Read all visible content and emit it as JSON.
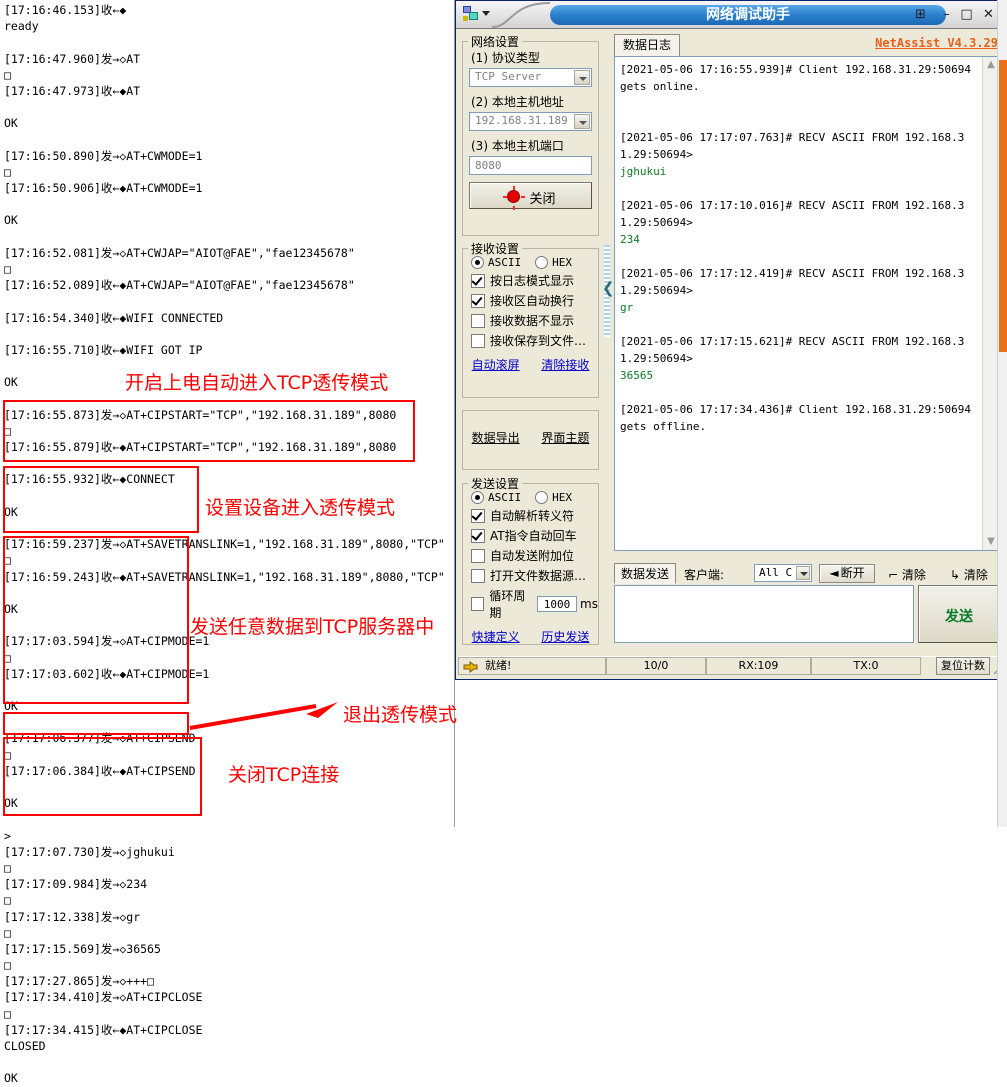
{
  "serial_log": {
    "lines": [
      "[17:16:46.153]收←◆",
      "ready",
      "",
      "[17:16:47.960]发→◇AT",
      "□",
      "[17:16:47.973]收←◆AT",
      "",
      "OK",
      "",
      "[17:16:50.890]发→◇AT+CWMODE=1",
      "□",
      "[17:16:50.906]收←◆AT+CWMODE=1",
      "",
      "OK",
      "",
      "[17:16:52.081]发→◇AT+CWJAP=\"AIOT@FAE\",\"fae12345678\"",
      "□",
      "[17:16:52.089]收←◆AT+CWJAP=\"AIOT@FAE\",\"fae12345678\"",
      "",
      "[17:16:54.340]收←◆WIFI CONNECTED",
      "",
      "[17:16:55.710]收←◆WIFI GOT IP",
      "",
      "OK",
      "",
      "[17:16:55.873]发→◇AT+CIPSTART=\"TCP\",\"192.168.31.189\",8080",
      "□",
      "[17:16:55.879]收←◆AT+CIPSTART=\"TCP\",\"192.168.31.189\",8080",
      "",
      "[17:16:55.932]收←◆CONNECT",
      "",
      "OK",
      "",
      "[17:16:59.237]发→◇AT+SAVETRANSLINK=1,\"192.168.31.189\",8080,\"TCP\"",
      "□",
      "[17:16:59.243]收←◆AT+SAVETRANSLINK=1,\"192.168.31.189\",8080,\"TCP\"",
      "",
      "OK",
      "",
      "[17:17:03.594]发→◇AT+CIPMODE=1",
      "□",
      "[17:17:03.602]收←◆AT+CIPMODE=1",
      "",
      "OK",
      "",
      "[17:17:06.377]发→◇AT+CIPSEND",
      "□",
      "[17:17:06.384]收←◆AT+CIPSEND",
      "",
      "OK",
      "",
      ">",
      "[17:17:07.730]发→◇jghukui",
      "□",
      "[17:17:09.984]发→◇234",
      "□",
      "[17:17:12.338]发→◇gr",
      "□",
      "[17:17:15.569]发→◇36565",
      "□",
      "[17:17:27.865]发→◇+++□",
      "[17:17:34.410]发→◇AT+CIPCLOSE",
      "□",
      "[17:17:34.415]收←◆AT+CIPCLOSE",
      "CLOSED",
      "",
      "OK"
    ]
  },
  "annotations": [
    {
      "id": "ann-tcp-auto",
      "text": "开启上电自动进入TCP透传模式"
    },
    {
      "id": "ann-transmit",
      "text": "设置设备进入透传模式"
    },
    {
      "id": "ann-senddata",
      "text": "发送任意数据到TCP服务器中"
    },
    {
      "id": "ann-exitmode",
      "text": "退出透传模式"
    },
    {
      "id": "ann-closetcp",
      "text": "关闭TCP连接"
    }
  ],
  "netassist": {
    "title": "网络调试助手",
    "brand_version": "NetAssist V4.3.29",
    "titlebar": {
      "pin": "⊞",
      "minimize": "–",
      "maximize": "□",
      "close": "✕"
    },
    "network_settings": {
      "legend": "网络设置",
      "protocol_label": "(1) 协议类型",
      "protocol_value": "TCP Server",
      "host_label": "(2) 本地主机地址",
      "host_value": "192.168.31.189",
      "port_label": "(3) 本地主机端口",
      "port_value": "8080",
      "action_button": "关闭"
    },
    "receive_settings": {
      "legend": "接收设置",
      "ascii": "ASCII",
      "hex": "HEX",
      "ascii_selected": true,
      "options": [
        {
          "label": "按日志模式显示",
          "checked": true
        },
        {
          "label": "接收区自动换行",
          "checked": true
        },
        {
          "label": "接收数据不显示",
          "checked": false
        },
        {
          "label": "接收保存到文件…",
          "checked": false
        }
      ],
      "links": [
        "自动滚屏",
        "清除接收"
      ]
    },
    "tools": {
      "links": [
        "数据导出",
        "界面主题"
      ]
    },
    "send_settings": {
      "legend": "发送设置",
      "ascii": "ASCII",
      "hex": "HEX",
      "ascii_selected": true,
      "options": [
        {
          "label": "自动解析转义符",
          "checked": true
        },
        {
          "label": "AT指令自动回车",
          "checked": true
        },
        {
          "label": "自动发送附加位",
          "checked": false
        },
        {
          "label": "打开文件数据源…",
          "checked": false
        }
      ],
      "cycle_label": "循环周期",
      "cycle_checked": false,
      "cycle_value": "1000",
      "cycle_unit": "ms",
      "links": [
        "快捷定义",
        "历史发送"
      ]
    },
    "log_panel": {
      "tab_label": "数据日志",
      "entries": [
        {
          "header": "[2021-05-06 17:16:55.939]# Client 192.168.31.29:50694 gets online.",
          "body": ""
        },
        {
          "header": "[2021-05-06 17:17:07.763]# RECV ASCII FROM 192.168.31.29:50694>",
          "body": "jghukui"
        },
        {
          "header": "[2021-05-06 17:17:10.016]# RECV ASCII FROM 192.168.31.29:50694>",
          "body": "234"
        },
        {
          "header": "[2021-05-06 17:17:12.419]# RECV ASCII FROM 192.168.31.29:50694>",
          "body": "gr"
        },
        {
          "header": "[2021-05-06 17:17:15.621]# RECV ASCII FROM 192.168.31.29:50694>",
          "body": "36565"
        },
        {
          "header": "[2021-05-06 17:17:34.436]# Client 192.168.31.29:50694 gets offline.",
          "body": ""
        }
      ]
    },
    "send_panel": {
      "tab_label": "数据发送",
      "client_label": "客户端:",
      "client_value": "All C",
      "disconnect_label": "断开",
      "clear_recv_label": "清除",
      "clear_send_label": "清除",
      "input_value": "",
      "send_button": "发送"
    },
    "status_bar": {
      "ready": "就绪!",
      "counter": "10/0",
      "rx": "RX:109",
      "tx": "TX:0",
      "reset": "复位计数"
    }
  }
}
